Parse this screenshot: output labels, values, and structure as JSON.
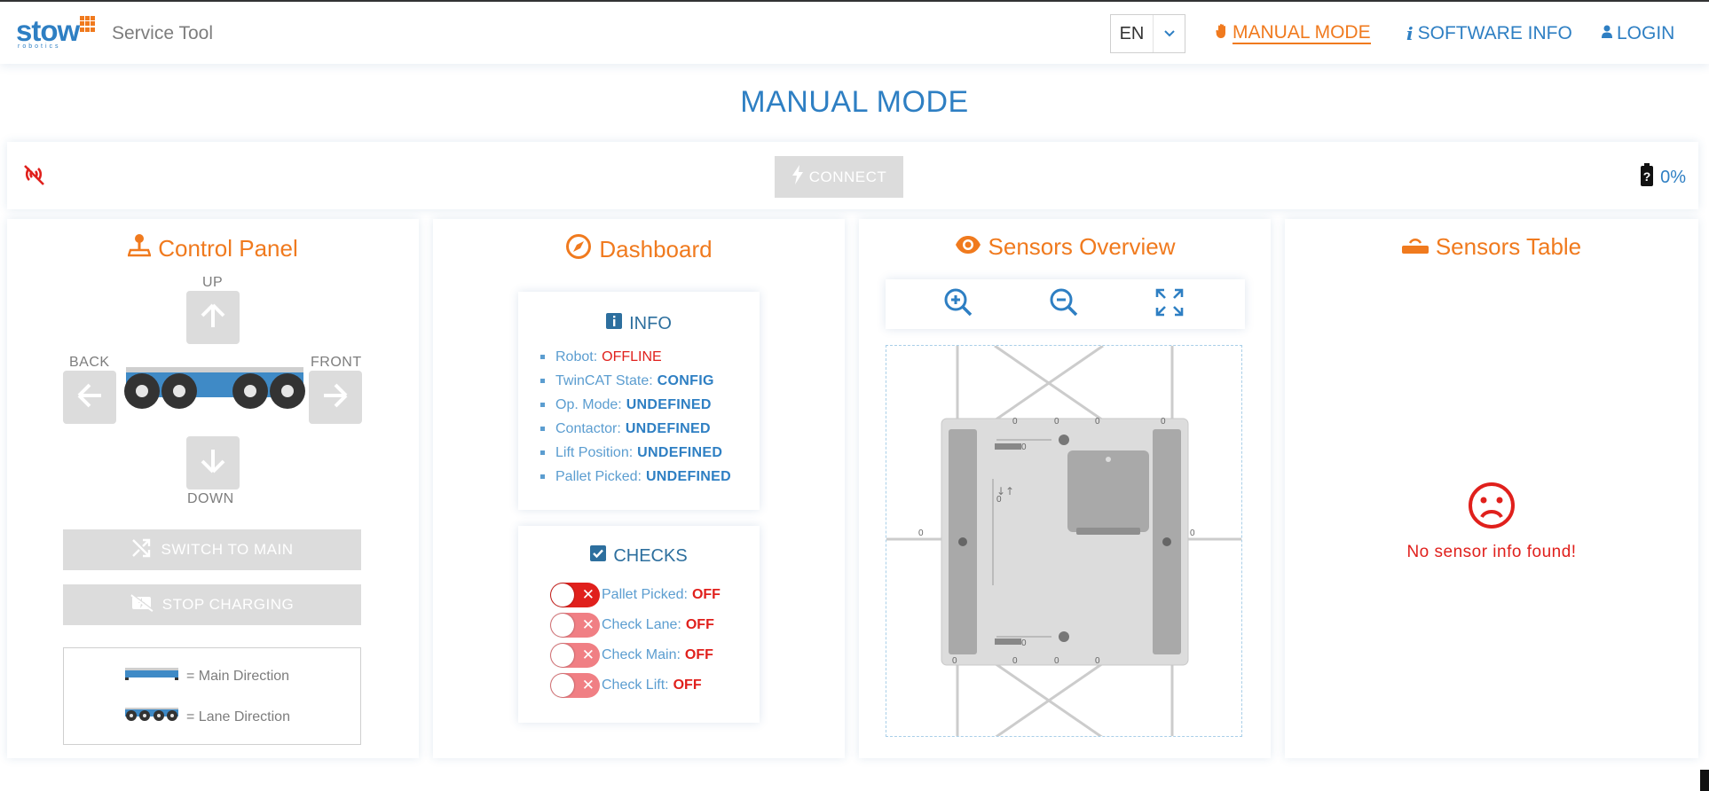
{
  "header": {
    "logo_text": "stow",
    "logo_subtext": "robotics",
    "app_title": "Service Tool",
    "language": "EN",
    "nav": {
      "manual_mode": "MANUAL MODE",
      "software_info": "SOFTWARE INFO",
      "login": "LOGIN"
    }
  },
  "page_title": "MANUAL MODE",
  "connection": {
    "connect_label": "CONNECT",
    "battery_percent": "0%"
  },
  "control_panel": {
    "title": "Control Panel",
    "up": "UP",
    "down": "DOWN",
    "back": "BACK",
    "front": "FRONT",
    "switch_label": "SWITCH TO MAIN",
    "stop_charging_label": "STOP CHARGING",
    "legend_main": "= Main Direction",
    "legend_lane": "= Lane Direction"
  },
  "dashboard": {
    "title": "Dashboard",
    "info_title": "INFO",
    "info": [
      {
        "label": "Robot:",
        "value": "OFFLINE"
      },
      {
        "label": "TwinCAT State:",
        "value": "CONFIG"
      },
      {
        "label": "Op. Mode:",
        "value": "UNDEFINED"
      },
      {
        "label": "Contactor:",
        "value": "UNDEFINED"
      },
      {
        "label": "Lift Position:",
        "value": "UNDEFINED"
      },
      {
        "label": "Pallet Picked:",
        "value": "UNDEFINED"
      }
    ],
    "checks_title": "CHECKS",
    "checks": [
      {
        "label": "Pallet Picked:",
        "value": "OFF"
      },
      {
        "label": "Check Lane:",
        "value": "OFF"
      },
      {
        "label": "Check Main:",
        "value": "OFF"
      },
      {
        "label": "Check Lift:",
        "value": "OFF"
      }
    ]
  },
  "sensors_overview": {
    "title": "Sensors Overview",
    "sensor_values": [
      "0",
      "0",
      "0",
      "0",
      "0",
      "0",
      "0",
      "0",
      "0",
      "0",
      "0",
      "0",
      "0"
    ]
  },
  "sensors_table": {
    "title": "Sensors Table",
    "empty_message": "No sensor info found!"
  },
  "colors": {
    "brand_blue": "#2e7fc3",
    "accent_orange": "#f07a1e",
    "error_red": "#e0201c",
    "disabled_gray": "#dcdcdc"
  }
}
